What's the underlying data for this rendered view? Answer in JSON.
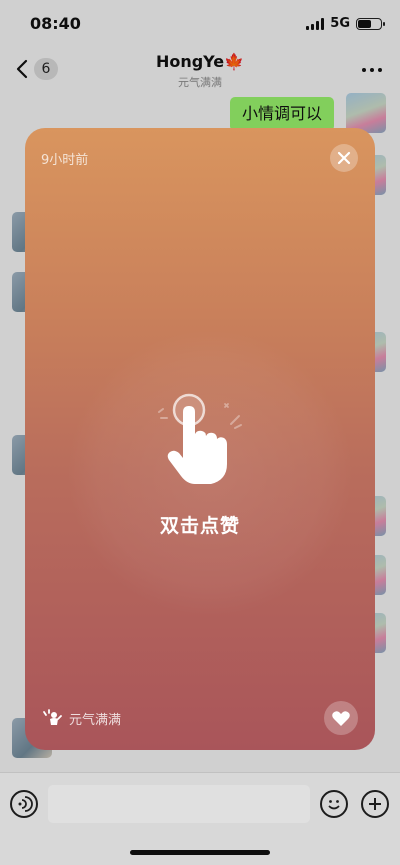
{
  "status_bar": {
    "time": "08:40",
    "network": "5G"
  },
  "nav": {
    "back_count": "6",
    "title": "HongYe🍁",
    "subtitle": "元气满满"
  },
  "chat": {
    "my_message": "小情调可以"
  },
  "moment_card": {
    "time_ago": "9小时前",
    "hint": "双击点赞",
    "status_label": "元气满满",
    "gradient": [
      "#d9955e",
      "#a9555a"
    ]
  },
  "bottom_bar": {
    "icons": [
      "voice-icon",
      "emoji-icon",
      "plus-icon"
    ]
  },
  "battery_level": 0.6
}
